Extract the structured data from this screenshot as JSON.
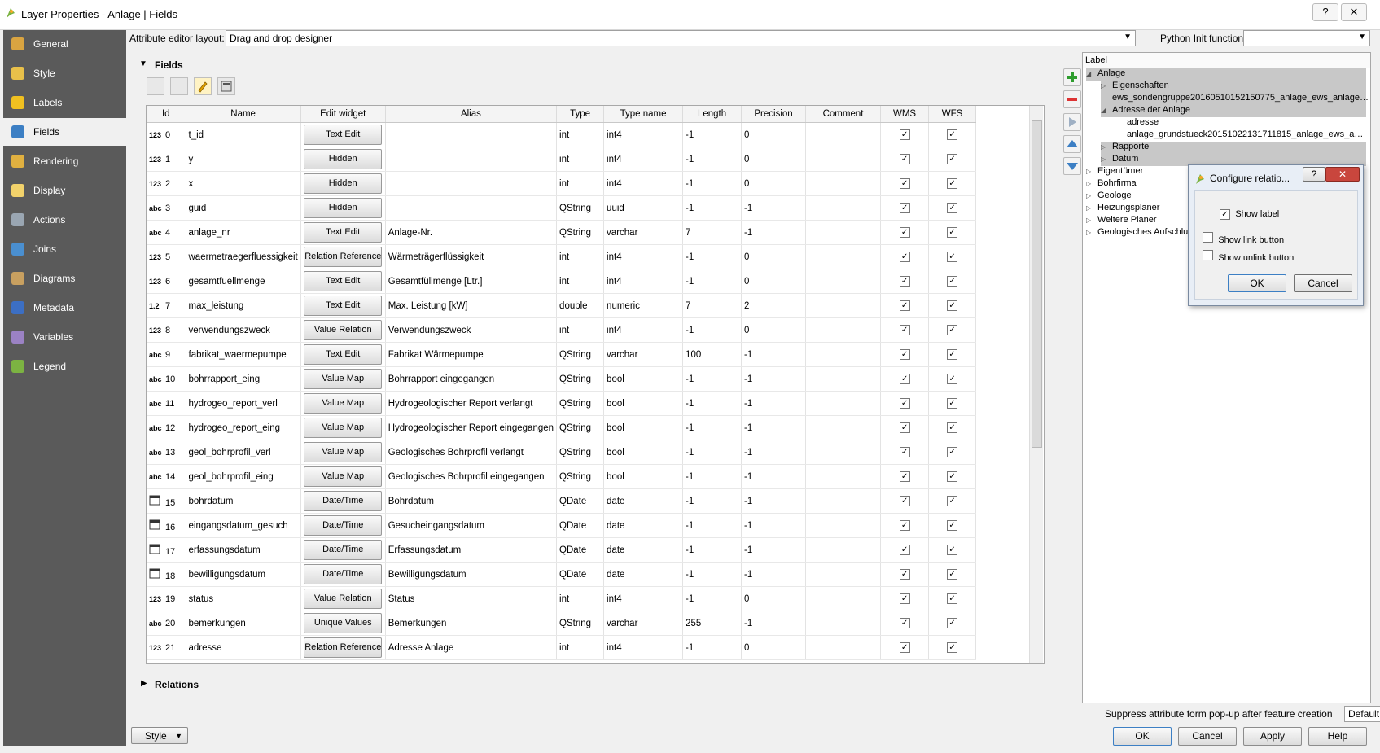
{
  "window": {
    "title": "Layer Properties - Anlage | Fields",
    "help": "?",
    "close": "✕"
  },
  "sidebar": {
    "items": [
      {
        "label": "General",
        "icon": "general-tools-icon"
      },
      {
        "label": "Style",
        "icon": "style-brush-icon"
      },
      {
        "label": "Labels",
        "icon": "labels-abc-icon"
      },
      {
        "label": "Fields",
        "icon": "fields-table-icon"
      },
      {
        "label": "Rendering",
        "icon": "rendering-brush-icon"
      },
      {
        "label": "Display",
        "icon": "display-bubble-icon"
      },
      {
        "label": "Actions",
        "icon": "actions-gear-icon"
      },
      {
        "label": "Joins",
        "icon": "joins-arrow-icon"
      },
      {
        "label": "Diagrams",
        "icon": "diagrams-icon"
      },
      {
        "label": "Metadata",
        "icon": "metadata-info-icon"
      },
      {
        "label": "Variables",
        "icon": "variables-epsilon-icon"
      },
      {
        "label": "Legend",
        "icon": "legend-list-icon"
      }
    ],
    "active": "Fields"
  },
  "top": {
    "layout_label": "Attribute editor layout:",
    "layout_value": "Drag and drop designer",
    "python_label": "Python Init function",
    "python_value": ""
  },
  "fields": {
    "group_title": "Fields",
    "headers": [
      "Id",
      "Name",
      "Edit widget",
      "Alias",
      "Type",
      "Type name",
      "Length",
      "Precision",
      "Comment",
      "WMS",
      "WFS"
    ],
    "rows": [
      {
        "type_badge": "123",
        "id": "0",
        "name": "t_id",
        "widget": "Text Edit",
        "alias": "",
        "type": "int",
        "type_name": "int4",
        "length": "-1",
        "precision": "0"
      },
      {
        "type_badge": "123",
        "id": "1",
        "name": "y",
        "widget": "Hidden",
        "alias": "",
        "type": "int",
        "type_name": "int4",
        "length": "-1",
        "precision": "0"
      },
      {
        "type_badge": "123",
        "id": "2",
        "name": "x",
        "widget": "Hidden",
        "alias": "",
        "type": "int",
        "type_name": "int4",
        "length": "-1",
        "precision": "0"
      },
      {
        "type_badge": "abc",
        "id": "3",
        "name": "guid",
        "widget": "Hidden",
        "alias": "",
        "type": "QString",
        "type_name": "uuid",
        "length": "-1",
        "precision": "-1"
      },
      {
        "type_badge": "abc",
        "id": "4",
        "name": "anlage_nr",
        "widget": "Text Edit",
        "alias": "Anlage-Nr.",
        "type": "QString",
        "type_name": "varchar",
        "length": "7",
        "precision": "-1"
      },
      {
        "type_badge": "123",
        "id": "5",
        "name": "waermetraegerfluessigkeit",
        "widget": "Relation Reference",
        "alias": "Wärmeträgerflüssigkeit",
        "type": "int",
        "type_name": "int4",
        "length": "-1",
        "precision": "0"
      },
      {
        "type_badge": "123",
        "id": "6",
        "name": "gesamtfuellmenge",
        "widget": "Text Edit",
        "alias": "Gesamtfüllmenge [Ltr.]",
        "type": "int",
        "type_name": "int4",
        "length": "-1",
        "precision": "0"
      },
      {
        "type_badge": "1.2",
        "id": "7",
        "name": "max_leistung",
        "widget": "Text Edit",
        "alias": "Max. Leistung [kW]",
        "type": "double",
        "type_name": "numeric",
        "length": "7",
        "precision": "2"
      },
      {
        "type_badge": "123",
        "id": "8",
        "name": "verwendungszweck",
        "widget": "Value Relation",
        "alias": "Verwendungszweck",
        "type": "int",
        "type_name": "int4",
        "length": "-1",
        "precision": "0"
      },
      {
        "type_badge": "abc",
        "id": "9",
        "name": "fabrikat_waermepumpe",
        "widget": "Text Edit",
        "alias": "Fabrikat Wärmepumpe",
        "type": "QString",
        "type_name": "varchar",
        "length": "100",
        "precision": "-1"
      },
      {
        "type_badge": "abc",
        "id": "10",
        "name": "bohrrapport_eing",
        "widget": "Value Map",
        "alias": "Bohrrapport eingegangen",
        "type": "QString",
        "type_name": "bool",
        "length": "-1",
        "precision": "-1"
      },
      {
        "type_badge": "abc",
        "id": "11",
        "name": "hydrogeo_report_verl",
        "widget": "Value Map",
        "alias": "Hydrogeologischer Report verlangt",
        "type": "QString",
        "type_name": "bool",
        "length": "-1",
        "precision": "-1"
      },
      {
        "type_badge": "abc",
        "id": "12",
        "name": "hydrogeo_report_eing",
        "widget": "Value Map",
        "alias": "Hydrogeologischer Report eingegangen",
        "type": "QString",
        "type_name": "bool",
        "length": "-1",
        "precision": "-1"
      },
      {
        "type_badge": "abc",
        "id": "13",
        "name": "geol_bohrprofil_verl",
        "widget": "Value Map",
        "alias": "Geologisches Bohrprofil verlangt",
        "type": "QString",
        "type_name": "bool",
        "length": "-1",
        "precision": "-1"
      },
      {
        "type_badge": "abc",
        "id": "14",
        "name": "geol_bohrprofil_eing",
        "widget": "Value Map",
        "alias": "Geologisches Bohrprofil eingegangen",
        "type": "QString",
        "type_name": "bool",
        "length": "-1",
        "precision": "-1"
      },
      {
        "type_badge": "cal",
        "id": "15",
        "name": "bohrdatum",
        "widget": "Date/Time",
        "alias": "Bohrdatum",
        "type": "QDate",
        "type_name": "date",
        "length": "-1",
        "precision": "-1"
      },
      {
        "type_badge": "cal",
        "id": "16",
        "name": "eingangsdatum_gesuch",
        "widget": "Date/Time",
        "alias": "Gesucheingangsdatum",
        "type": "QDate",
        "type_name": "date",
        "length": "-1",
        "precision": "-1"
      },
      {
        "type_badge": "cal",
        "id": "17",
        "name": "erfassungsdatum",
        "widget": "Date/Time",
        "alias": "Erfassungsdatum",
        "type": "QDate",
        "type_name": "date",
        "length": "-1",
        "precision": "-1"
      },
      {
        "type_badge": "cal",
        "id": "18",
        "name": "bewilligungsdatum",
        "widget": "Date/Time",
        "alias": "Bewilligungsdatum",
        "type": "QDate",
        "type_name": "date",
        "length": "-1",
        "precision": "-1"
      },
      {
        "type_badge": "123",
        "id": "19",
        "name": "status",
        "widget": "Value Relation",
        "alias": "Status",
        "type": "int",
        "type_name": "int4",
        "length": "-1",
        "precision": "0"
      },
      {
        "type_badge": "abc",
        "id": "20",
        "name": "bemerkungen",
        "widget": "Unique Values",
        "alias": "Bemerkungen",
        "type": "QString",
        "type_name": "varchar",
        "length": "255",
        "precision": "-1"
      },
      {
        "type_badge": "123",
        "id": "21",
        "name": "adresse",
        "widget": "Relation Reference",
        "alias": "Adresse Anlage",
        "type": "int",
        "type_name": "int4",
        "length": "-1",
        "precision": "0"
      }
    ],
    "checked": "✓"
  },
  "relations": {
    "title": "Relations"
  },
  "tree": {
    "header": "Label",
    "items": [
      {
        "label": "Anlage",
        "level": 0,
        "selected": true,
        "arrow": "◢"
      },
      {
        "label": "Eigenschaften",
        "level": 1,
        "selected": true,
        "arrow": "▷"
      },
      {
        "label": "ews_sondengruppe20160510152150775_anlage_ews_anlage…",
        "level": 1,
        "selected": true,
        "arrow": ""
      },
      {
        "label": "Adresse der Anlage",
        "level": 1,
        "selected": true,
        "arrow": "◢"
      },
      {
        "label": "adresse",
        "level": 2,
        "selected": false,
        "arrow": ""
      },
      {
        "label": "anlage_grundstueck20151022131711815_anlage_ews_a…",
        "level": 2,
        "selected": false,
        "arrow": ""
      },
      {
        "label": "Rapporte",
        "level": 1,
        "selected": true,
        "arrow": "▷"
      },
      {
        "label": "Datum",
        "level": 1,
        "selected": true,
        "arrow": "▷"
      },
      {
        "label": "Eigentümer",
        "level": 0,
        "selected": false,
        "arrow": "▷"
      },
      {
        "label": "Bohrfirma",
        "level": 0,
        "selected": false,
        "arrow": "▷"
      },
      {
        "label": "Geologe",
        "level": 0,
        "selected": false,
        "arrow": "▷"
      },
      {
        "label": "Heizungsplaner",
        "level": 0,
        "selected": false,
        "arrow": "▷"
      },
      {
        "label": "Weitere Planer",
        "level": 0,
        "selected": false,
        "arrow": "▷"
      },
      {
        "label": "Geologisches Aufschlu…",
        "level": 0,
        "selected": false,
        "arrow": "▷"
      }
    ]
  },
  "dialog": {
    "title": "Configure relatio...",
    "help": "?",
    "close": "✕",
    "show_label": "Show label",
    "show_link": "Show link button",
    "show_unlink": "Show unlink button",
    "show_label_checked": "✓",
    "ok": "OK",
    "cancel": "Cancel"
  },
  "bottom": {
    "suppress_label": "Suppress attribute form pop-up after feature creation",
    "suppress_value": "Default",
    "style": "Style",
    "ok": "OK",
    "cancel": "Cancel",
    "apply": "Apply",
    "help": "Help"
  }
}
